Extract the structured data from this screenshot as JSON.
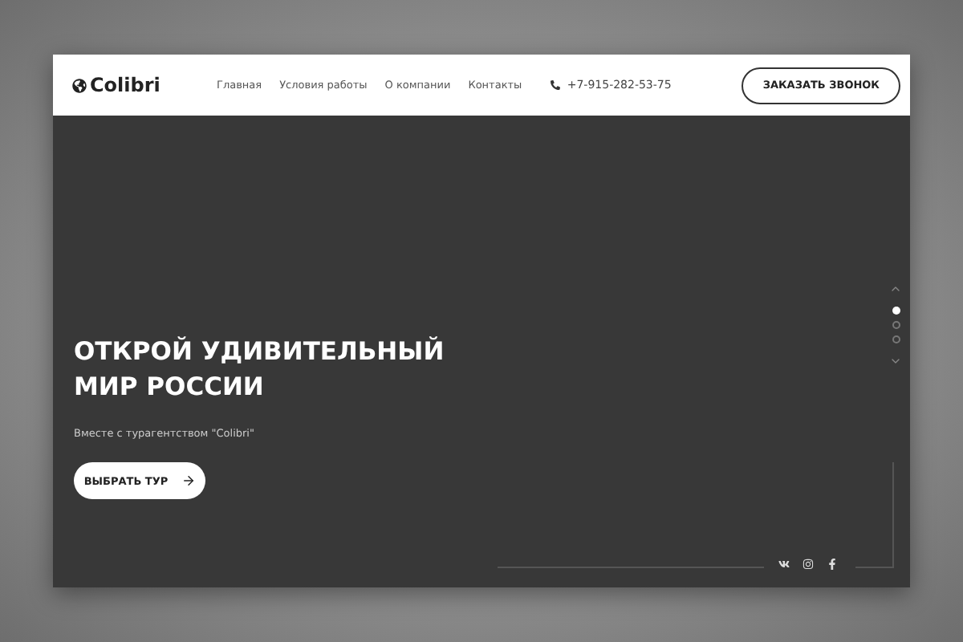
{
  "header": {
    "logo": "Colibri",
    "nav": [
      {
        "label": "Главная"
      },
      {
        "label": "Условия работы"
      },
      {
        "label": "О компании"
      },
      {
        "label": "Контакты"
      }
    ],
    "phone": "+7-915-282-53-75",
    "cta": "ЗАКАЗАТЬ ЗВОНОК"
  },
  "hero": {
    "title_lines": [
      "ОТКРОЙ УДИВИТЕЛЬНЫЙ",
      "МИР РОССИИ"
    ],
    "subtitle": "Вместе с турагентством \"Colibri\"",
    "button": "ВЫБРАТЬ ТУР"
  },
  "slides": [
    {
      "selected": true
    },
    {
      "selected": false
    },
    {
      "selected": false
    }
  ],
  "social": [
    {
      "kind": "vk"
    },
    {
      "kind": "instagram"
    },
    {
      "kind": "facebook"
    }
  ]
}
